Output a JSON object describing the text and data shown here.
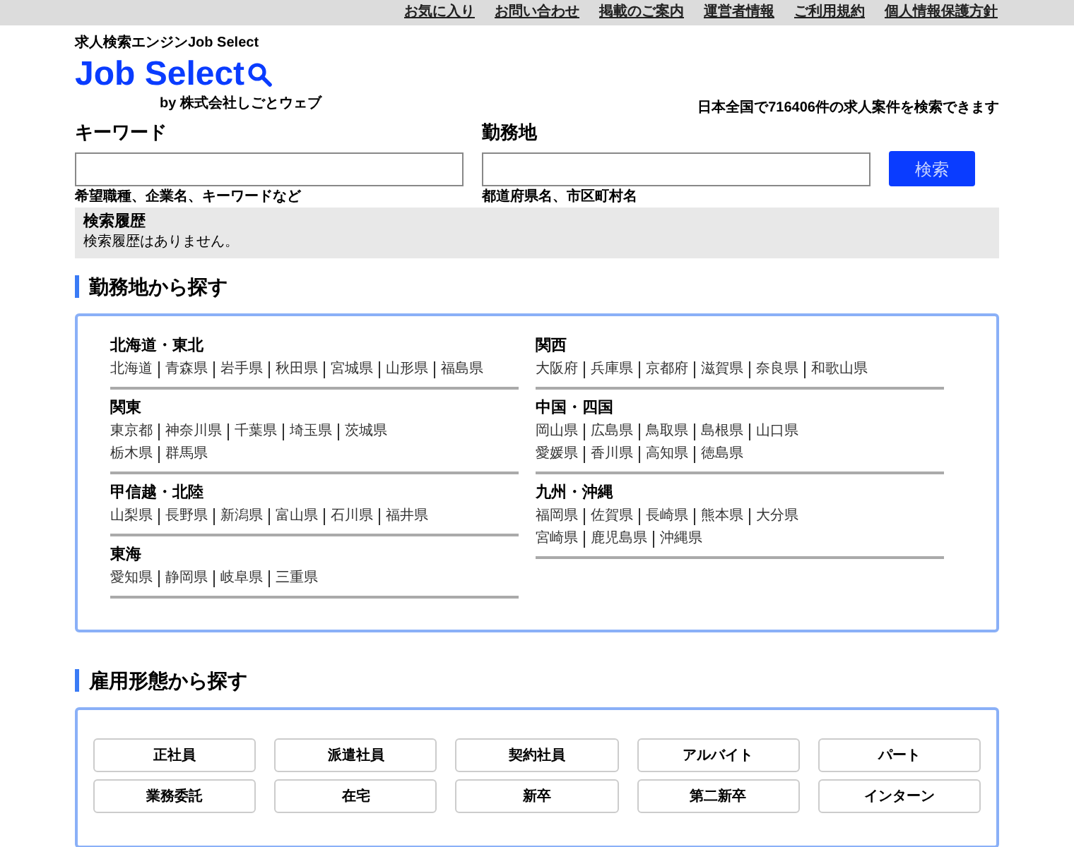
{
  "top_links": [
    "お気に入り",
    "お問い合わせ",
    "掲載のご案内",
    "運営者情報",
    "ご利用規約",
    "個人情報保護方針"
  ],
  "header": {
    "tagline": "求人検索エンジンJob Select",
    "logo": "Job Select",
    "byline": "by 株式会社しごとウェブ",
    "count_text": "日本全国で716406件の求人案件を検索できます"
  },
  "search": {
    "keyword_label": "キーワード",
    "keyword_hint": "希望職種、企業名、キーワードなど",
    "location_label": "勤務地",
    "location_hint": "都道府県名、市区町村名",
    "button": "検索"
  },
  "history": {
    "title": "検索履歴",
    "message": "検索履歴はありません。"
  },
  "area_section": {
    "title": "勤務地から探す",
    "columns": [
      [
        {
          "name": "北海道・東北",
          "lines": [
            [
              "北海道",
              "青森県",
              "岩手県",
              "秋田県",
              "宮城県",
              "山形県",
              "福島県"
            ]
          ]
        },
        {
          "name": "関東",
          "lines": [
            [
              "東京都",
              "神奈川県",
              "千葉県",
              "埼玉県",
              "茨城県"
            ],
            [
              "栃木県",
              "群馬県"
            ]
          ]
        },
        {
          "name": "甲信越・北陸",
          "lines": [
            [
              "山梨県",
              "長野県",
              "新潟県",
              "富山県",
              "石川県",
              "福井県"
            ]
          ]
        },
        {
          "name": "東海",
          "lines": [
            [
              "愛知県",
              "静岡県",
              "岐阜県",
              "三重県"
            ]
          ]
        }
      ],
      [
        {
          "name": "関西",
          "lines": [
            [
              "大阪府",
              "兵庫県",
              "京都府",
              "滋賀県",
              "奈良県",
              "和歌山県"
            ]
          ]
        },
        {
          "name": "中国・四国",
          "lines": [
            [
              "岡山県",
              "広島県",
              "鳥取県",
              "島根県",
              "山口県"
            ],
            [
              "愛媛県",
              "香川県",
              "高知県",
              "徳島県"
            ]
          ]
        },
        {
          "name": "九州・沖縄",
          "lines": [
            [
              "福岡県",
              "佐賀県",
              "長崎県",
              "熊本県",
              "大分県"
            ],
            [
              "宮崎県",
              "鹿児島県",
              "沖縄県"
            ]
          ]
        }
      ]
    ]
  },
  "employment_section": {
    "title": "雇用形態から探す",
    "types": [
      "正社員",
      "派遣社員",
      "契約社員",
      "アルバイト",
      "パート",
      "業務委託",
      "在宅",
      "新卒",
      "第二新卒",
      "インターン"
    ]
  }
}
